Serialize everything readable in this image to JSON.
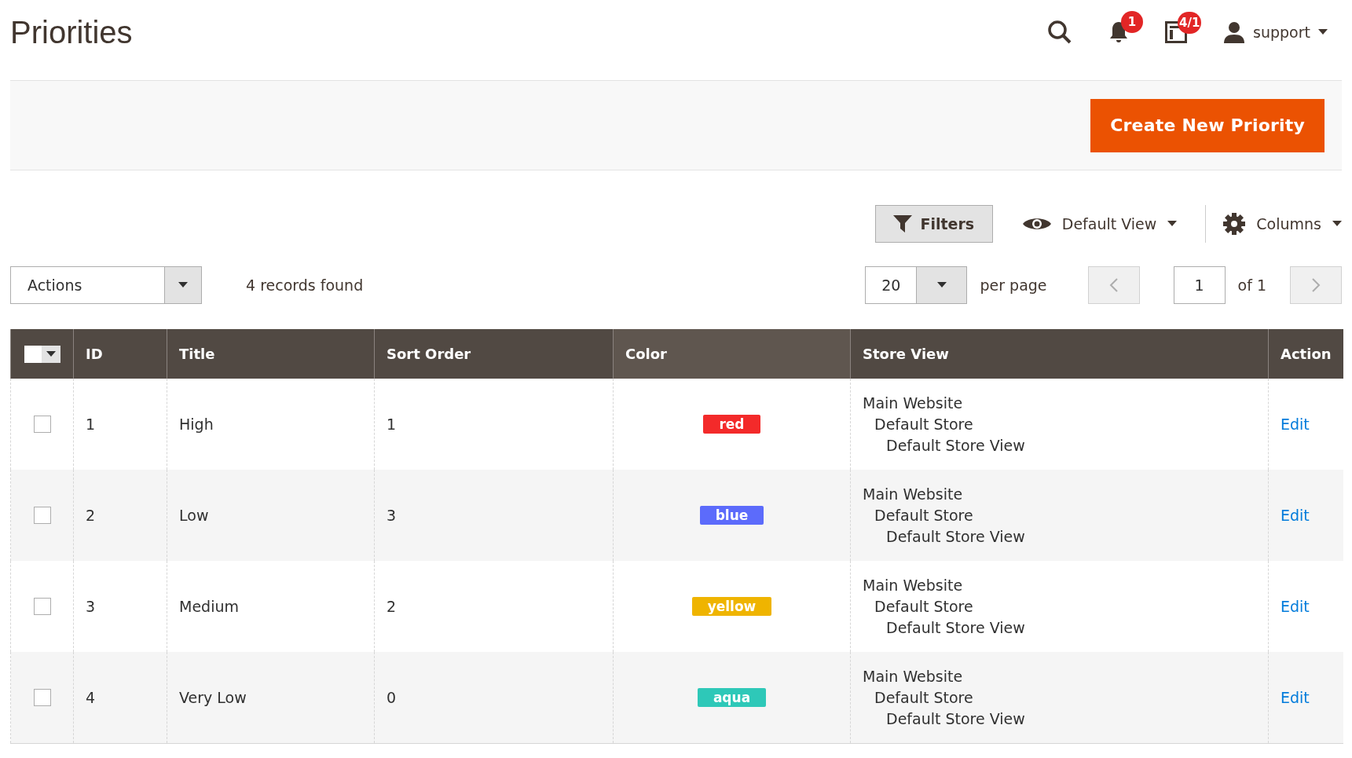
{
  "page_title": "Priorities",
  "header": {
    "notifications_badge": "1",
    "system_messages_badge": "4/1",
    "user": "support"
  },
  "page_actions": {
    "primary_button": "Create New Priority"
  },
  "toolbar": {
    "filters_button": "Filters",
    "view": "Default View",
    "columns": "Columns"
  },
  "grid_controls": {
    "actions": "Actions",
    "records_found": "4 records found",
    "per_page_value": "20",
    "per_page_label": "per page",
    "page_value": "1",
    "page_total": "of 1"
  },
  "table": {
    "select_all": {
      "checked": false
    },
    "columns": [
      {
        "label": "ID",
        "sorted": false
      },
      {
        "label": "Title",
        "sorted": false
      },
      {
        "label": "Sort Order",
        "sorted": false
      },
      {
        "label": "Color",
        "sorted": true
      },
      {
        "label": "Store View",
        "sorted": false
      },
      {
        "label": "Action",
        "sorted": false
      }
    ],
    "rows": [
      {
        "checked": false,
        "id": "1",
        "title": "High",
        "sort_order": "1",
        "color_label": "red",
        "color": "#f32a2a",
        "store_view": [
          "Main Website",
          "Default Store",
          "Default Store View"
        ],
        "action": "Edit"
      },
      {
        "checked": false,
        "id": "2",
        "title": "Low",
        "sort_order": "3",
        "color_label": "blue",
        "color": "#5c6bfb",
        "store_view": [
          "Main Website",
          "Default Store",
          "Default Store View"
        ],
        "action": "Edit"
      },
      {
        "checked": false,
        "id": "3",
        "title": "Medium",
        "sort_order": "2",
        "color_label": "yellow",
        "color": "#efb400",
        "store_view": [
          "Main Website",
          "Default Store",
          "Default Store View"
        ],
        "action": "Edit"
      },
      {
        "checked": false,
        "id": "4",
        "title": "Very Low",
        "sort_order": "0",
        "color_label": "aqua",
        "color": "#2ec8b8",
        "store_view": [
          "Main Website",
          "Default Store",
          "Default Store View"
        ],
        "action": "Edit"
      }
    ]
  }
}
